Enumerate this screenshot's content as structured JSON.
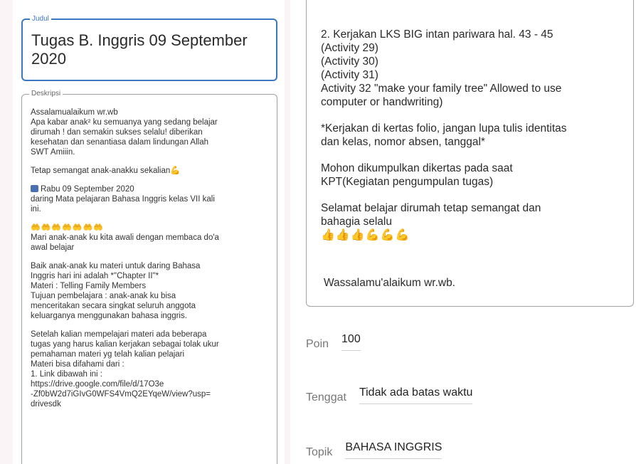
{
  "judul": {
    "label": "Judul",
    "value": "Tugas B. Inggris 09 September 2020"
  },
  "deskripsi": {
    "label": "Deskripsi",
    "lines": [
      "Assalamualaikum wr.wb",
      "Apa kabar anak² ku semuanya yang sedang belajar",
      "dirumah ! dan semakin sukses selalu! diberikan",
      "kesehatan dan senantiasa dalam lindungan Allah",
      "SWT Amiiin.",
      "Tetap semangat anak-anakku sekalian",
      "Rabu 09 September 2020",
      "daring Mata pelajaran Bahasa Inggris kelas VII kali",
      "ini.",
      " Mari anak-anak ku kita awali dengan membaca do'a",
      "awal belajar",
      "Baik anak-anak ku materi untuk daring Bahasa",
      "Inggris hari ini adalah *\"Chapter II\"*",
      "Materi : Telling Family Members",
      "Tujuan pembelajara : anak-anak ku bisa",
      "menceritakan secara singkat seluruh anggota",
      "keluarganya menggunakan bahasa inggris.",
      "Setelah kalian mempelajari materi ada beberapa",
      "tugas yang harus kalian kerjakan sebagai tolak ukur",
      "pemahaman materi yg telah  kalian pelajari",
      "Materi bisa difahami dari :",
      "1. Link dibawah ini :",
      "https://drive.google.com/file/d/17O3e",
      "-Zf0bW2d7iGIvG0WFS4VmQ2EYqeW/view?usp=",
      "drivesdk"
    ]
  },
  "content": {
    "lines": [
      "2. Kerjakan LKS BIG intan pariwara hal. 43 - 45",
      "(Activity 29)",
      "(Activity 30)",
      "(Activity 31)",
      "Activity 32 \"make your family tree\" Allowed to use",
      "computer or handwriting)",
      "*Kerjakan  di kertas folio, jangan lupa tulis identitas",
      "dan kelas, nomor absen, tanggal*",
      "Mohon dikumpulkan dikertas pada saat",
      "KPT(Kegiatan pengumpulan tugas)",
      "Selamat belajar dirumah tetap semangat dan",
      "bahagia selalu"
    ],
    "closing": "Wassalamu'alaikum wr.wb."
  },
  "fields": {
    "poin_label": "Poin",
    "poin_value": "100",
    "tenggat_label": "Tenggat",
    "tenggat_value": "Tidak ada batas waktu",
    "topik_label": "Topik",
    "topik_value": "BAHASA INGGRIS"
  },
  "colors": {
    "accent": "#3b78c4",
    "background": "#fbf4f6"
  }
}
